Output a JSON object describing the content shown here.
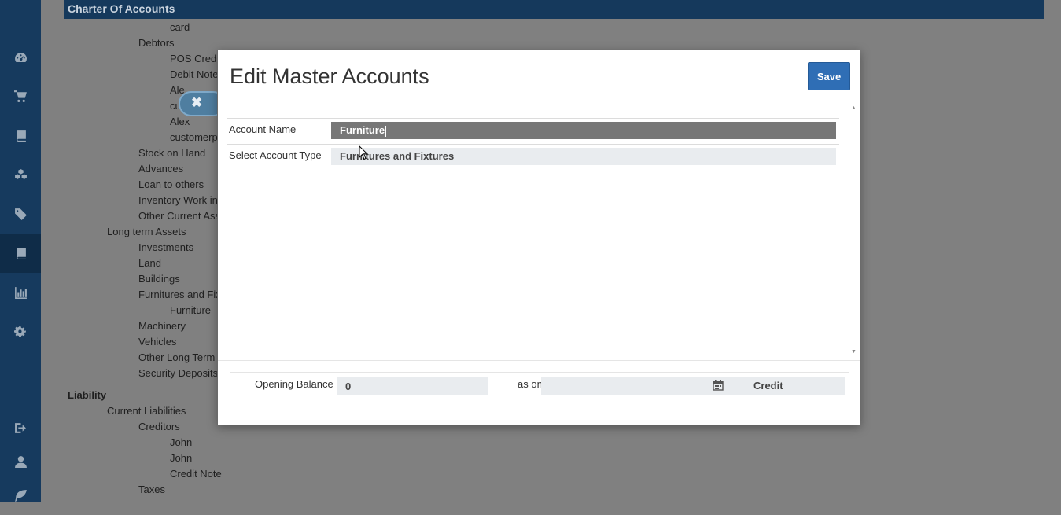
{
  "sidebar": {
    "items": [
      {
        "icon": "dashboard-icon"
      },
      {
        "icon": "cart-icon"
      },
      {
        "icon": "book-icon"
      },
      {
        "icon": "cubes-icon"
      },
      {
        "icon": "tags-icon"
      },
      {
        "icon": "ledger-icon",
        "active": true
      },
      {
        "icon": "bar-chart-icon"
      },
      {
        "icon": "cogs-icon"
      },
      {
        "icon": "sign-out-icon"
      },
      {
        "icon": "user-icon"
      },
      {
        "icon": "leaf-icon"
      }
    ]
  },
  "page": {
    "title": "Charter Of Accounts",
    "tree": [
      "card",
      "Debtors",
      "POS Credit",
      "Debit Note",
      "Ale",
      "cu",
      "Alex",
      "customerp",
      "Stock on Hand",
      "Advances",
      "Loan to others",
      "Inventory Work in",
      "Other Current Ass",
      "Long term Assets",
      "Investments",
      "Land",
      "Buildings",
      "Furnitures and Fix",
      "Furniture",
      "Machinery",
      "Vehicles",
      "Other Long Term A",
      "Security Deposits",
      "Liability",
      "Current Liabilities",
      "Creditors",
      "John",
      "John",
      "Credit Note",
      "Taxes"
    ]
  },
  "close_pill": {
    "icon": "close-icon"
  },
  "modal": {
    "title": "Edit Master Accounts",
    "save_label": "Save",
    "account_name_label": "Account Name",
    "account_name_value": "Furniture",
    "account_type_label": "Select Account Type",
    "account_type_value": "Furnitures and Fixtures",
    "opening_balance_label": "Opening Balance",
    "opening_balance_value": "0",
    "as_on_label": "as on",
    "as_on_value": "",
    "balance_type": "Credit"
  },
  "colors": {
    "sidebar": "#163a5e",
    "title_bar": "#15395c",
    "overlay": "#808080",
    "save_button": "#2f6eb5",
    "account_name_input": "#777777"
  }
}
